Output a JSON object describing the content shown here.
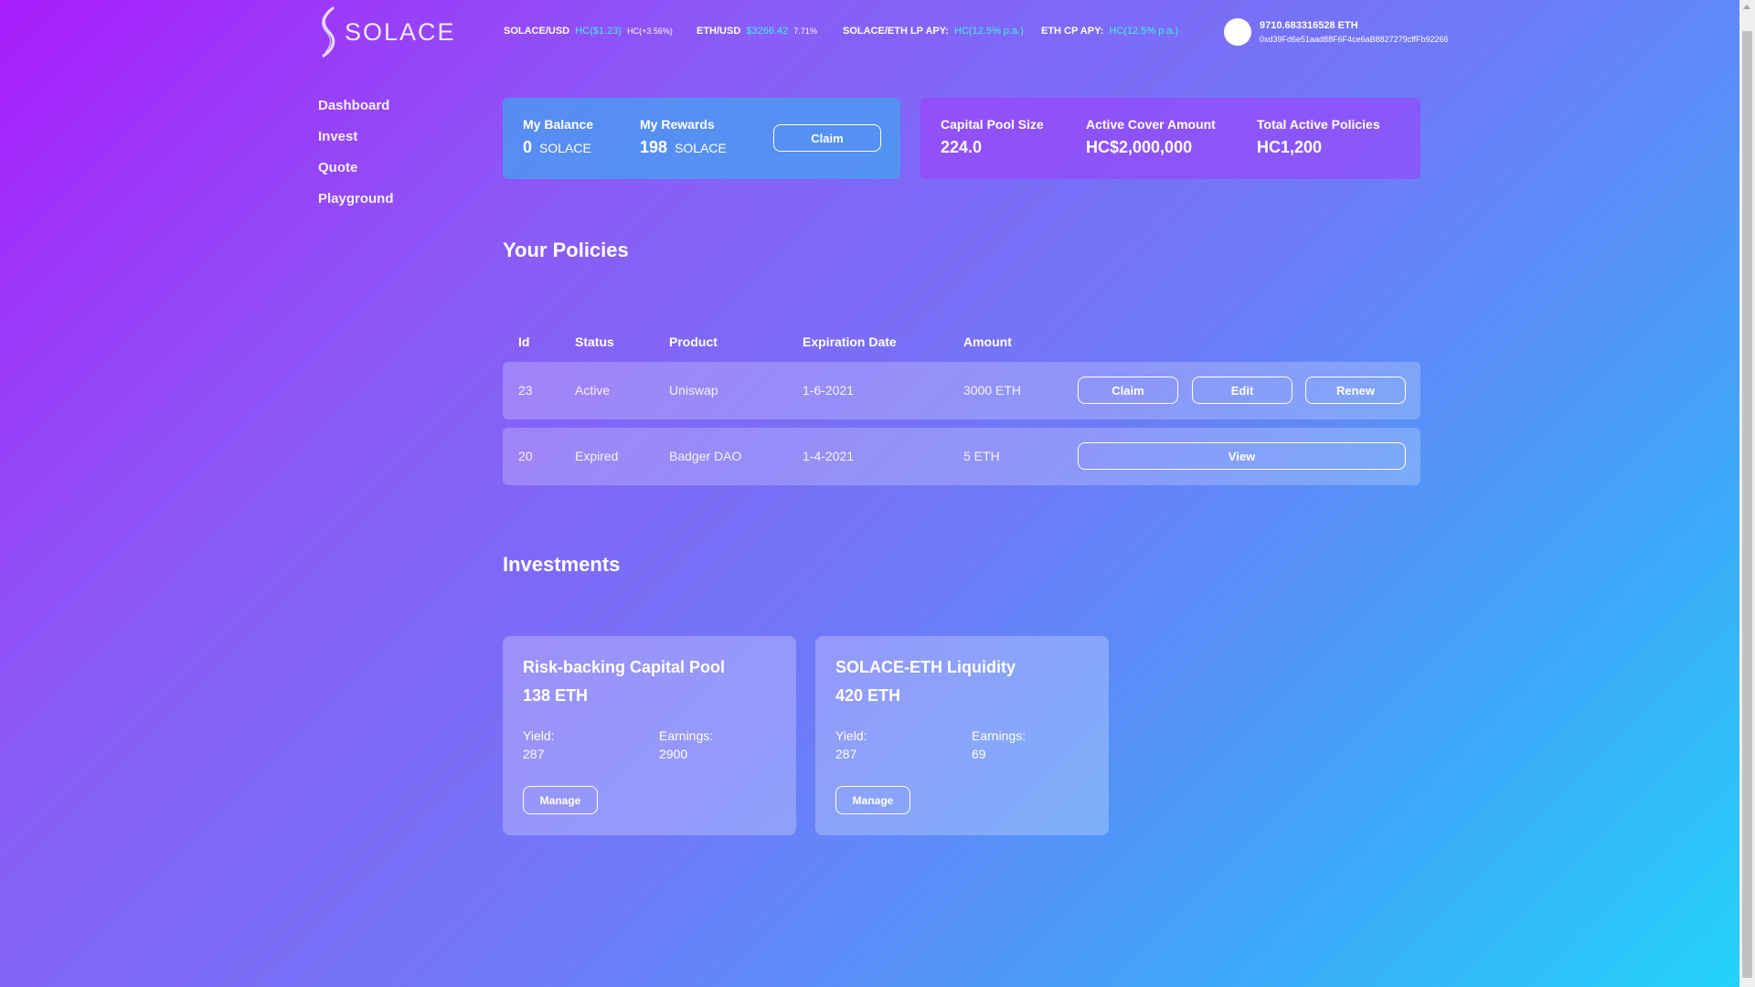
{
  "brand": {
    "name": "SOLACE"
  },
  "ticker": {
    "solace_usd": {
      "label": "SOLACE/USD",
      "value": "HC($1.23)",
      "change": "HC(+3.56%)"
    },
    "eth_usd": {
      "label": "ETH/USD",
      "value": "$3266.42",
      "change": "7.71%"
    },
    "lp_apy": {
      "label": "SOLACE/ETH LP APY:",
      "value": "HC(12.5% p.a.)"
    },
    "cp_apy": {
      "label": "ETH CP APY:",
      "value": "HC(12.5% p.a.)"
    }
  },
  "wallet": {
    "balance": "9710.683316528 ETH",
    "address": "0xd39Fd6e51aad88F6F4ce6aB8827279cffFb92266"
  },
  "sidebar": {
    "items": [
      {
        "label": "Dashboard"
      },
      {
        "label": "Invest"
      },
      {
        "label": "Quote"
      },
      {
        "label": "Playground"
      }
    ]
  },
  "account_panel": {
    "balance_label": "My Balance",
    "balance_value": "0",
    "balance_unit": "SOLACE",
    "rewards_label": "My Rewards",
    "rewards_value": "198",
    "rewards_unit": "SOLACE",
    "claim_label": "Claim"
  },
  "stats_panel": {
    "pool_label": "Capital Pool Size",
    "pool_value": "224.0",
    "cover_label": "Active Cover Amount",
    "cover_value": "HC$2,000,000",
    "policies_label": "Total Active Policies",
    "policies_value": "HC1,200"
  },
  "policies": {
    "title": "Your Policies",
    "columns": {
      "id": "Id",
      "status": "Status",
      "product": "Product",
      "expiration": "Expiration Date",
      "amount": "Amount"
    },
    "rows": [
      {
        "id": "23",
        "status": "Active",
        "product": "Uniswap",
        "expiration": "1-6-2021",
        "amount": "3000 ETH",
        "actions": {
          "claim": "Claim",
          "edit": "Edit",
          "renew": "Renew"
        }
      },
      {
        "id": "20",
        "status": "Expired",
        "product": "Badger DAO",
        "expiration": "1-4-2021",
        "amount": "5 ETH",
        "actions": {
          "view": "View"
        }
      }
    ]
  },
  "investments": {
    "title": "Investments",
    "cards": [
      {
        "name": "Risk-backing Capital Pool",
        "amount": "138 ETH",
        "yield_label": "Yield:",
        "yield_value": "287",
        "earnings_label": "Earnings:",
        "earnings_value": "2900",
        "button": "Manage"
      },
      {
        "name": "SOLACE-ETH Liquidity",
        "amount": "420 ETH",
        "yield_label": "Yield:",
        "yield_value": "287",
        "earnings_label": "Earnings:",
        "earnings_value": "69",
        "button": "Manage"
      }
    ]
  },
  "colors": {
    "accent_cyan": "#3ff0e6",
    "gradient_start": "#a91dfb",
    "gradient_end": "#22d4fa"
  }
}
